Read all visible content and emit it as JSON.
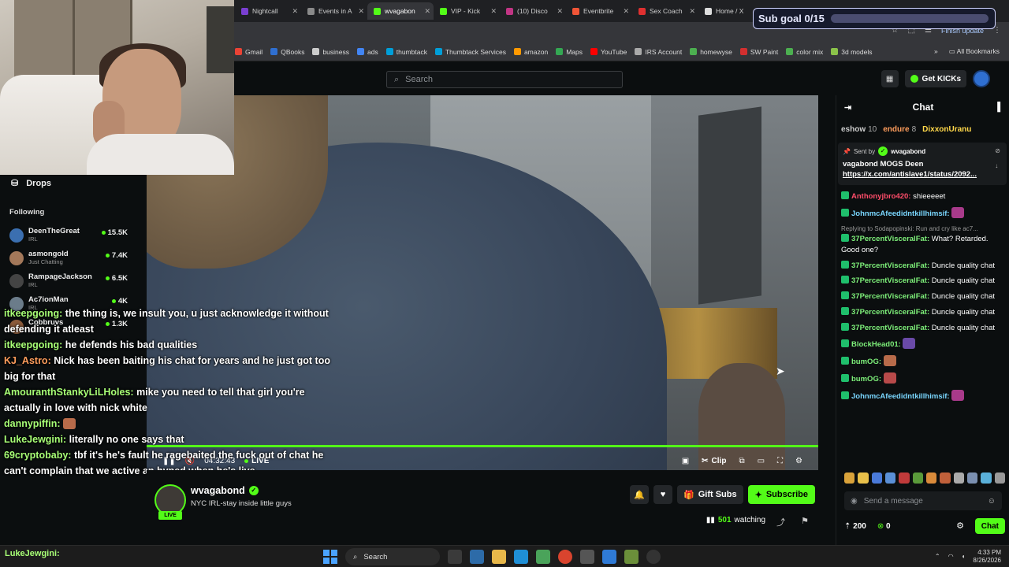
{
  "browser": {
    "tabs": [
      {
        "label": "Nightcall",
        "color": "#7a3fd1"
      },
      {
        "label": "Events in A",
        "color": "#8a8a8a"
      },
      {
        "label": "wvagabon",
        "color": "#53fc18",
        "active": true
      },
      {
        "label": "VIP - Kick",
        "color": "#53fc18"
      },
      {
        "label": "(10) Disco",
        "color": "#c13584"
      },
      {
        "label": "Eventbrite",
        "color": "#f05537"
      },
      {
        "label": "Sex Coach",
        "color": "#e03030"
      },
      {
        "label": "Home / X",
        "color": "#dddddd"
      }
    ],
    "finish_update": "Finish update",
    "bookmarks": [
      {
        "label": "Gmail",
        "color": "#ea4335"
      },
      {
        "label": "QBooks",
        "color": "#2f6fd1"
      },
      {
        "label": "business",
        "color": "#cccccc"
      },
      {
        "label": "ads",
        "color": "#4285f4"
      },
      {
        "label": "thumbtack",
        "color": "#009fd9"
      },
      {
        "label": "Thumbtack Services",
        "color": "#009fd9"
      },
      {
        "label": "amazon",
        "color": "#ff9900"
      },
      {
        "label": "Maps",
        "color": "#34a853"
      },
      {
        "label": "YouTube",
        "color": "#ff0000"
      },
      {
        "label": "IRS Account",
        "color": "#aaaaaa"
      },
      {
        "label": "homewyse",
        "color": "#4caf50"
      },
      {
        "label": "SW Paint",
        "color": "#d32f2f"
      },
      {
        "label": "color mix",
        "color": "#4caf50"
      },
      {
        "label": "3d models",
        "color": "#8bc34a"
      }
    ],
    "all_bookmarks": "All Bookmarks"
  },
  "kick": {
    "search_placeholder": "Search",
    "get_kicks": "Get KICKs"
  },
  "sub_goal": {
    "label": "Sub goal 0/15",
    "progress": 0
  },
  "sidebar": {
    "drops": "Drops",
    "following": "Following",
    "channels": [
      {
        "name": "DeenTheGreat",
        "category": "IRL",
        "viewers": "15.5K",
        "color": "#3b6fb0"
      },
      {
        "name": "asmongold",
        "category": "Just Chatting",
        "viewers": "7.4K",
        "color": "#a3785a"
      },
      {
        "name": "RampageJackson",
        "category": "IRL",
        "viewers": "6.5K",
        "color": "#444444"
      },
      {
        "name": "Ac7ionMan",
        "category": "IRL",
        "viewers": "4K",
        "color": "#6b7c8a"
      },
      {
        "name": "Cobbruvs",
        "category": "IRL",
        "viewers": "1.3K",
        "color": "#8a5a3a"
      }
    ]
  },
  "video": {
    "time": "04:32:43",
    "live": "LIVE",
    "clip": "Clip"
  },
  "overlay_chat": [
    {
      "user": "itkeepgoing:",
      "text": "the thing is, we insult you, u just acknowledge it without defending it atleast"
    },
    {
      "user": "itkeepgoing:",
      "text": "he defends his bad qualities"
    },
    {
      "user": "KJ_Astro:",
      "text": "Nick has been baiting his chat for years and he just got too big for that",
      "orange": true
    },
    {
      "user": "AmouranthStankyLiLHoles:",
      "text": "mike you need to tell that girl you're actually in love with nick white"
    },
    {
      "user": "dannypiffin:",
      "text": ""
    },
    {
      "user": "LukeJewgini:",
      "text": "literally no one says that"
    },
    {
      "user": "69cryptobaby:",
      "text": "tbf it's he's fault he ragebaited the fuck out of chat he can't complain that we active an hyped when he's live"
    }
  ],
  "stream": {
    "streamer": "wvagabond",
    "title": "NYC IRL-stay inside little guys",
    "gift_subs": "Gift Subs",
    "subscribe": "Subscribe",
    "watching_count": "501",
    "watching_label": "watching"
  },
  "chat": {
    "title": "Chat",
    "gifters": [
      {
        "name": "eshow",
        "count": "10",
        "color": "#cccccc"
      },
      {
        "name": "endure",
        "count": "8",
        "color": "#ff9d5c"
      },
      {
        "name": "DixxonUranu",
        "count": "",
        "color": "#ffd84a"
      }
    ],
    "pinned": {
      "sent_by": "Sent by",
      "sender": "wvagabond",
      "message": "vagabond MOGS Deen",
      "link": "https://x.com/antislave1/status/2092..."
    },
    "messages": [
      {
        "user": "Anthonyjbro420:",
        "text": "shieeeeet",
        "color": "#ff4d6a"
      },
      {
        "user": "JohnmcAfeedidntkillhimsif:",
        "text": "",
        "color": "#7ad7ff"
      },
      {
        "reply": "Replying to Sodapopinski: Run and cry like ac7...",
        "user": "37PercentVisceralFat:",
        "text": "What? Retarded. Good one?",
        "color": "#7ef07a"
      },
      {
        "user": "37PercentVisceralFat:",
        "text": "Duncle quality chat",
        "color": "#7ef07a"
      },
      {
        "user": "37PercentVisceralFat:",
        "text": "Duncle quality chat",
        "color": "#7ef07a"
      },
      {
        "user": "37PercentVisceralFat:",
        "text": "Duncle quality chat",
        "color": "#7ef07a"
      },
      {
        "user": "37PercentVisceralFat:",
        "text": "Duncle quality chat",
        "color": "#7ef07a"
      },
      {
        "user": "37PercentVisceralFat:",
        "text": "Duncle quality chat",
        "color": "#7ef07a"
      },
      {
        "user": "BlockHead01:",
        "text": "",
        "color": "#7ef07a"
      },
      {
        "user": "bumOG:",
        "text": "",
        "color": "#7ef07a"
      },
      {
        "user": "bumOG:",
        "text": "",
        "color": "#7ef07a"
      },
      {
        "user": "JohnmcAfeedidntkillhimsif:",
        "text": "",
        "color": "#7ad7ff"
      }
    ],
    "send_placeholder": "Send a message",
    "points": "200",
    "kicks": "0",
    "chat_button": "Chat"
  },
  "taskbar": {
    "user": "LukeJewgini:",
    "search": "Search",
    "time": "4:33 PM",
    "date": "8/26/2026"
  }
}
